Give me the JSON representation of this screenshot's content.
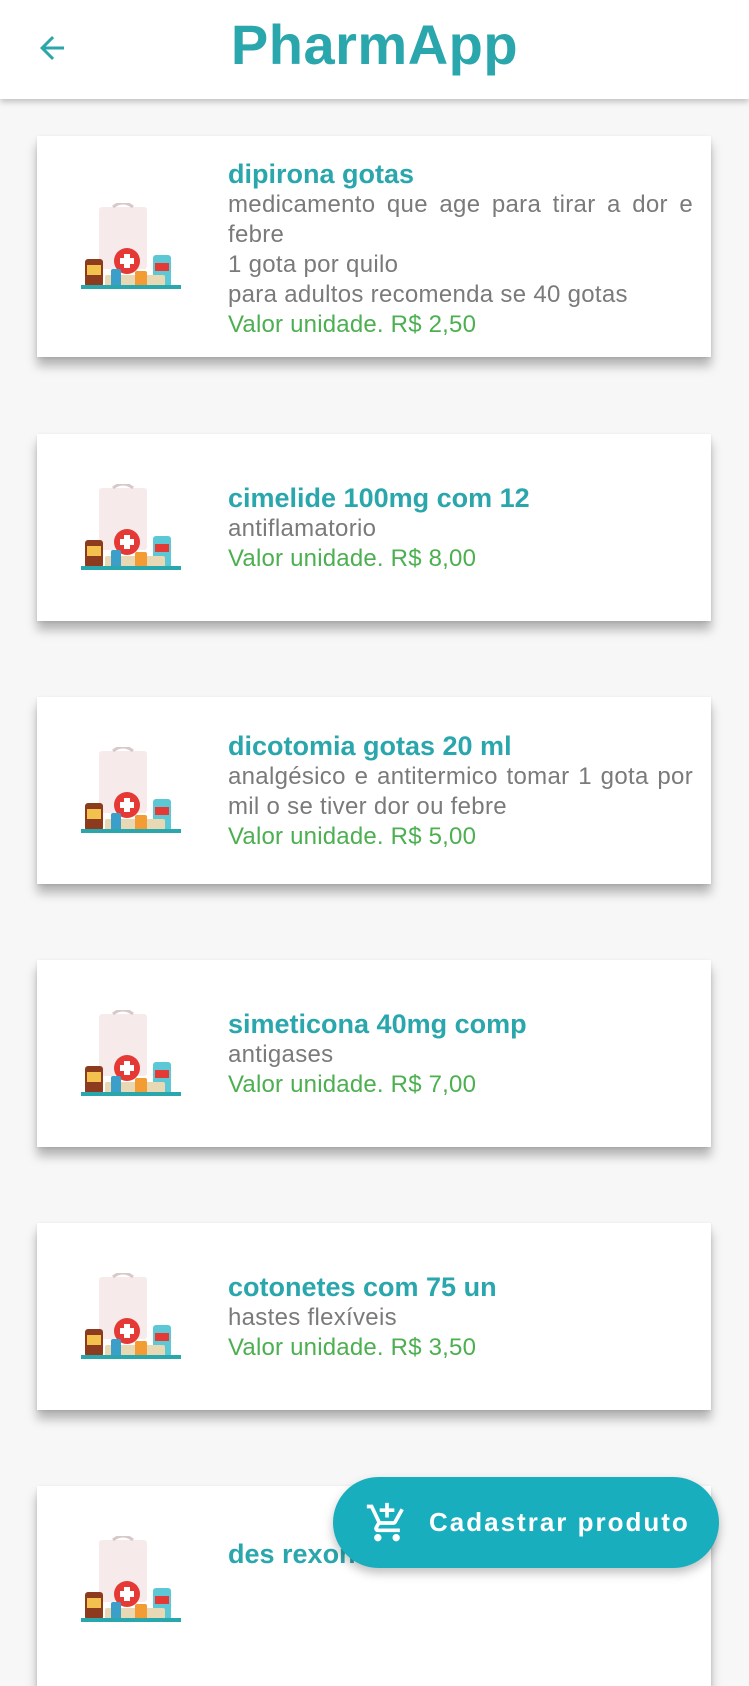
{
  "app": {
    "title": "PharmApp",
    "back_icon": "arrow-left-icon",
    "colors": {
      "primary": "#2aa6ad",
      "price": "#4caf50",
      "fab": "#18aebd"
    }
  },
  "products": [
    {
      "name": "dipirona gotas",
      "description": "medicamento que age para tirar a dor e febre\n1 gota por quilo\npara adultos recomenda se 40 gotas",
      "price": "Valor unidade. R$ 2,50",
      "image_icon": "pharmacy-products-icon"
    },
    {
      "name": "cimelide 100mg com 12",
      "description": "antiflamatorio",
      "price": "Valor unidade. R$ 8,00",
      "image_icon": "pharmacy-products-icon"
    },
    {
      "name": "dicotomia gotas 20 ml",
      "description": "analgésico e antitermico  tomar 1 gota por mil o se tiver dor ou febre",
      "price": "Valor unidade. R$ 5,00",
      "image_icon": "pharmacy-products-icon"
    },
    {
      "name": "simeticona 40mg comp",
      "description": "antigases",
      "price": "Valor unidade. R$ 7,00",
      "image_icon": "pharmacy-products-icon"
    },
    {
      "name": "cotonetes com 75 un",
      "description": "hastes flexíveis",
      "price": "Valor unidade. R$ 3,50",
      "image_icon": "pharmacy-products-icon"
    },
    {
      "name": "des rexona aerosol",
      "description": "",
      "price": "",
      "image_icon": "pharmacy-products-icon"
    }
  ],
  "fab": {
    "label": "Cadastrar produto",
    "icon": "add-shopping-cart-icon"
  }
}
